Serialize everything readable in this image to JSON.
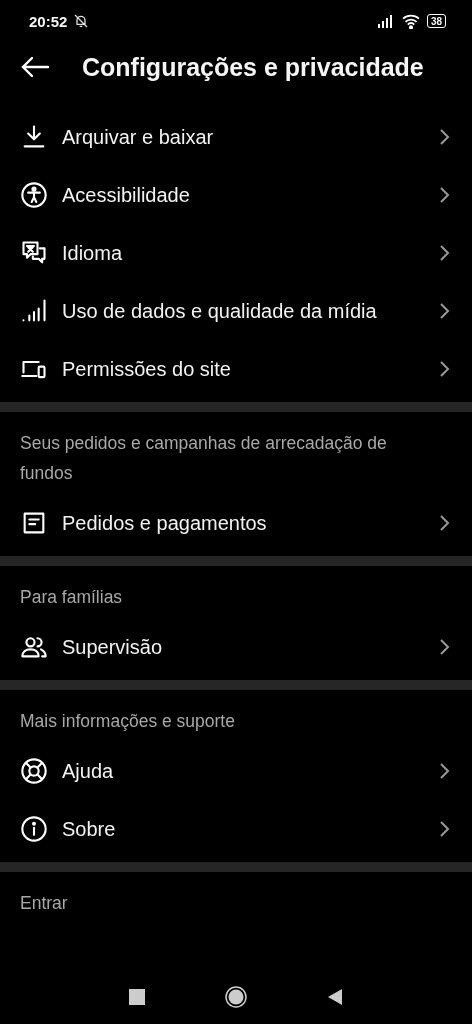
{
  "status_bar": {
    "time": "20:52",
    "battery": "38"
  },
  "header": {
    "title": "Configurações e privacidade"
  },
  "sections": [
    {
      "items": [
        {
          "label": "Arquivar e baixar",
          "kind": "download"
        },
        {
          "label": "Acessibilidade",
          "kind": "accessibility"
        },
        {
          "label": "Idioma",
          "kind": "language"
        },
        {
          "label": "Uso de dados e qualidade da mídia",
          "kind": "signal"
        },
        {
          "label": "Permissões do site",
          "kind": "devices"
        }
      ]
    },
    {
      "title": "Seus pedidos e campanhas de arrecadação de fundos",
      "items": [
        {
          "label": "Pedidos e pagamentos",
          "kind": "receipt"
        }
      ]
    },
    {
      "title": "Para famílias",
      "items": [
        {
          "label": "Supervisão",
          "kind": "people"
        }
      ]
    },
    {
      "title": "Mais informações e suporte",
      "items": [
        {
          "label": "Ajuda",
          "kind": "lifebuoy"
        },
        {
          "label": "Sobre",
          "kind": "info"
        }
      ]
    },
    {
      "title": "Entrar"
    }
  ]
}
